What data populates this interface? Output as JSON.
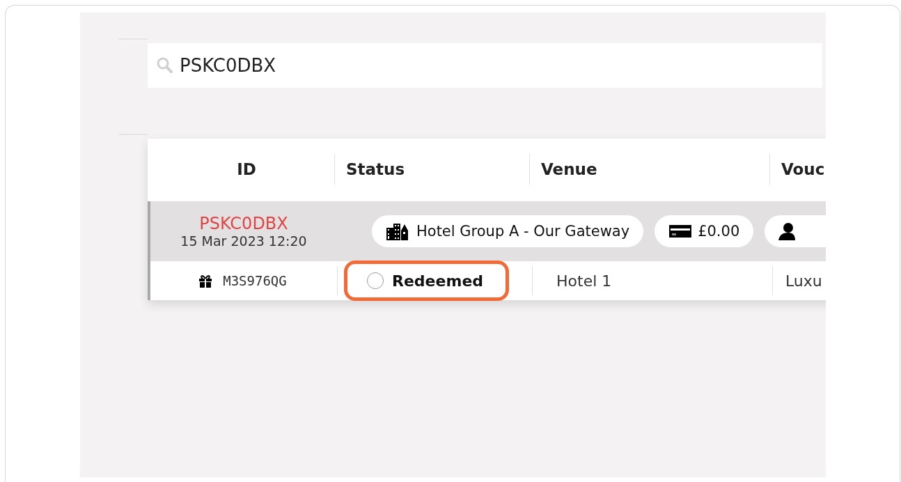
{
  "search": {
    "value": "PSKC0DBX"
  },
  "table": {
    "columns": [
      "ID",
      "Status",
      "Venue",
      "Vouc"
    ],
    "group": {
      "id": "PSKC0DBX",
      "date": "15 Mar 2023 12:20",
      "pills": [
        {
          "kind": "venue",
          "label": "Hotel Group A - Our Gateway"
        },
        {
          "kind": "payment",
          "label": "£0.00"
        },
        {
          "kind": "person"
        }
      ]
    },
    "rows": [
      {
        "code": "M3S976QG",
        "status": "Redeemed",
        "highlighted": true,
        "venue": "Hotel 1",
        "voucher": "Luxu"
      }
    ]
  }
}
